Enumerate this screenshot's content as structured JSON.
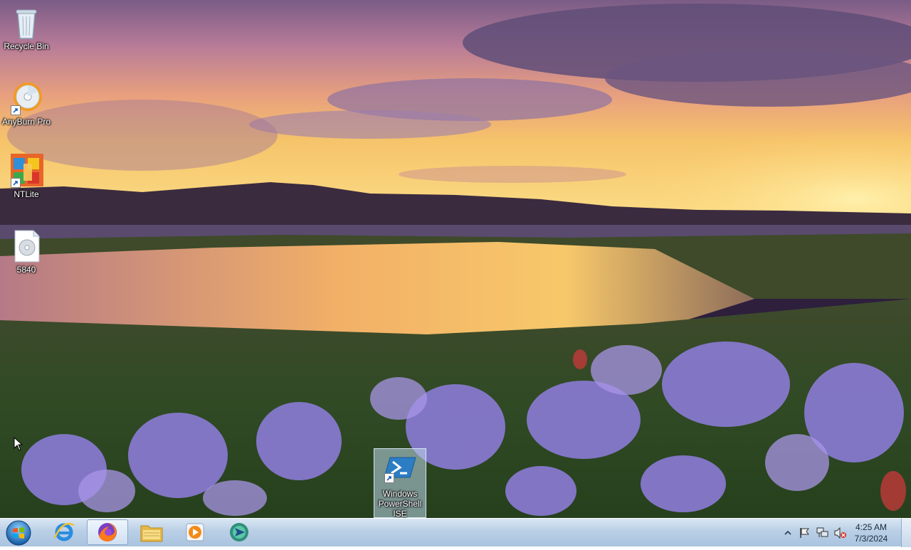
{
  "desktop": {
    "icons": [
      {
        "label": "Recycle Bin",
        "icon": "recycle-bin-icon"
      },
      {
        "label": "AnyBurn Pro",
        "icon": "disc-burner-icon"
      },
      {
        "label": "NTLite",
        "icon": "ntlite-icon"
      },
      {
        "label": "5840",
        "icon": "disc-image-file-icon"
      },
      {
        "label": "Windows PowerShell ISE",
        "icon": "powershell-icon"
      }
    ]
  },
  "taskbar": {
    "start_icon": "windows-orb-icon",
    "pinned": [
      {
        "name": "Internet Explorer",
        "icon": "internet-explorer-icon"
      },
      {
        "name": "Firefox",
        "icon": "firefox-icon",
        "active": true
      },
      {
        "name": "File Explorer",
        "icon": "folder-icon"
      },
      {
        "name": "Media Player",
        "icon": "media-player-icon"
      },
      {
        "name": "Unknown App",
        "icon": "globe-arrow-icon"
      }
    ],
    "tray": {
      "icons": [
        "show-hidden-icons-chevron",
        "action-center-flag-icon",
        "network-icon",
        "volume-muted-icon"
      ],
      "time": "4:25 AM",
      "date": "7/3/2024"
    }
  },
  "colors": {
    "taskbar_top": "#d9e6f3",
    "taskbar_bottom": "#a9c3df",
    "selection": "#bed7eb"
  }
}
